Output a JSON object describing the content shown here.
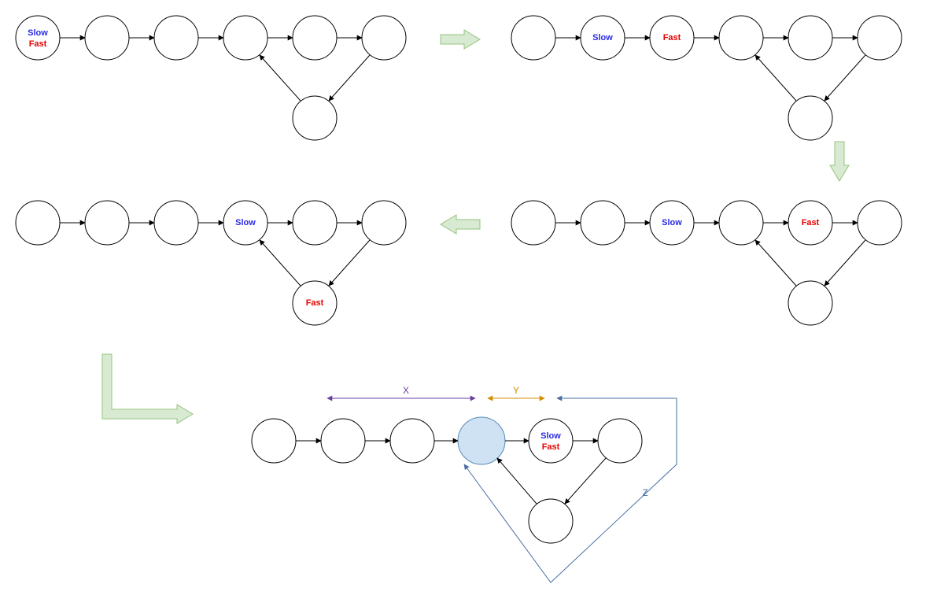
{
  "labels": {
    "slow": "Slow",
    "fast": "Fast",
    "X": "X",
    "Y": "Y",
    "Z": "Z"
  },
  "colors": {
    "slow": "#2a2ae6",
    "fast": "#e60000",
    "big_arrow_fill": "#d9ead3",
    "big_arrow_stroke": "#93c47d",
    "highlight_node_fill": "#cfe2f3",
    "highlight_node_stroke": "#5b8bb5",
    "X_line": "#6b3fa0",
    "Y_line": "#d68b00",
    "Z_line": "#4a6fa5"
  },
  "steps": [
    {
      "id": "step1",
      "nodes": 7,
      "slow_index": 0,
      "fast_index": 0,
      "cycle_entry_index": 3,
      "note": "Both pointers at head"
    },
    {
      "id": "step2",
      "nodes": 7,
      "slow_index": 1,
      "fast_index": 2,
      "cycle_entry_index": 3,
      "note": "slow moved 1, fast moved 2"
    },
    {
      "id": "step3",
      "nodes": 7,
      "slow_index": 2,
      "fast_index": 4,
      "cycle_entry_index": 3,
      "note": "slow moved 1, fast moved 2"
    },
    {
      "id": "step4",
      "nodes": 7,
      "slow_index": 3,
      "fast_index": 6,
      "cycle_entry_index": 3,
      "note": "slow at cycle entry, fast at bottom cycle node"
    },
    {
      "id": "step5",
      "nodes": 7,
      "slow_index": 4,
      "fast_index": 4,
      "cycle_entry_index": 3,
      "highlight_index": 3,
      "note": "Pointers meet; cycle entry highlighted; distances X, Y, Z labeled"
    }
  ],
  "distances": {
    "X": {
      "from_index": 0,
      "to_index": 3,
      "description": "head to cycle entry"
    },
    "Y": {
      "from_index": 3,
      "to_index": 4,
      "description": "cycle entry to meeting point"
    },
    "Z": {
      "from_index": 4,
      "to_index": 3,
      "description": "meeting point around cycle back to entry"
    }
  }
}
